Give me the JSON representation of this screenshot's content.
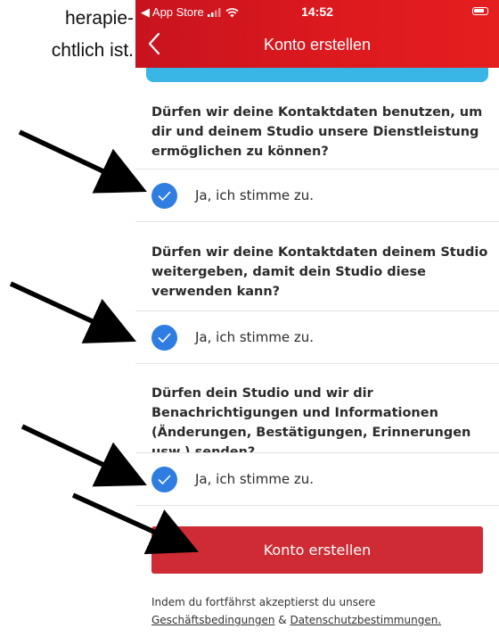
{
  "document": {
    "line1": "herapie-",
    "line2": "chtlich ist."
  },
  "status_bar": {
    "back_app": "◀ App Store",
    "time": "14:52"
  },
  "nav": {
    "title": "Konto erstellen"
  },
  "consents": [
    {
      "question": "Dürfen wir deine Kontaktdaten benutzen, um dir und deinem Studio unsere Dienstleistung ermöglichen zu können?",
      "label": "Ja, ich stimme zu.",
      "checked": true
    },
    {
      "question": "Dürfen wir deine Kontaktdaten deinem Studio weitergeben, damit dein Studio diese verwenden kann?",
      "label": "Ja, ich stimme zu.",
      "checked": true
    },
    {
      "question": "Dürfen dein Studio und wir dir Benachrichtigungen und Informationen (Änderungen, Bestätigungen, Erinnerungen usw.) senden?",
      "label": "Ja, ich stimme zu.",
      "checked": true
    }
  ],
  "submit_label": "Konto erstellen",
  "legal": {
    "intro": "Indem du fortfährst akzeptierst du unsere",
    "terms_link": "Geschäftsbedingungen",
    "and": "&",
    "privacy_link": "Datenschutzbestimmungen."
  },
  "colors": {
    "brand_red": "#de1a1e",
    "button_red": "#cf2b34",
    "check_blue": "#2f7de1",
    "accent_blue": "#39b6e6"
  }
}
